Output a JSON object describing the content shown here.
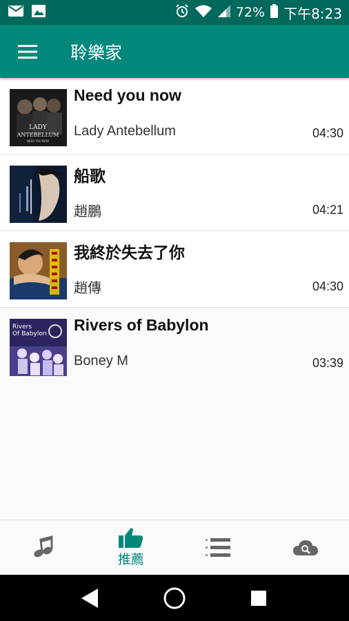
{
  "status_bar": {
    "battery_percent": "72%",
    "time": "下午8:23"
  },
  "app_bar": {
    "title": "聆樂家"
  },
  "songs": [
    {
      "title": "Need you now",
      "artist": "Lady Antebellum",
      "duration": "04:30",
      "cover_text": "LADY ANTEBELLUM"
    },
    {
      "title": "船歌",
      "artist": "趙鵬",
      "duration": "04:21",
      "cover_text": ""
    },
    {
      "title": "我終於失去了你",
      "artist": "趙傳",
      "duration": "04:30",
      "cover_text": ""
    },
    {
      "title": "Rivers of Babylon",
      "artist": "Boney M",
      "duration": "03:39",
      "cover_text": "Rivers Of Babylon"
    }
  ],
  "bottom_nav": {
    "recommend_label": "推薦",
    "accent_color": "#00897b",
    "icons": [
      "music-note-icon",
      "thumbs-up-icon",
      "list-icon",
      "cloud-search-icon"
    ]
  },
  "colors": {
    "status_bar": "#00695c",
    "app_bar": "#00897b"
  }
}
